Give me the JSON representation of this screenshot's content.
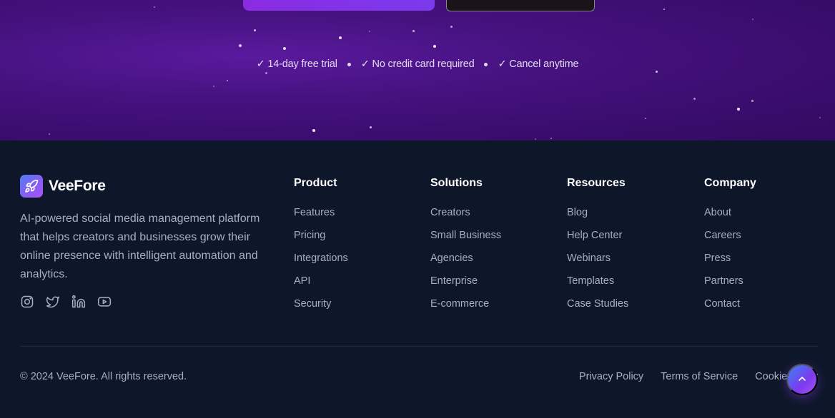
{
  "hero": {
    "primary_cta": "",
    "secondary_cta": "",
    "trust_items": [
      "✓ 14-day free trial",
      "✓ No credit card required",
      "✓ Cancel anytime"
    ],
    "colors": {
      "background": "#3a0d6e",
      "accent": "#7c3aed"
    }
  },
  "footer": {
    "brand": {
      "name": "VeeFore",
      "description": "AI-powered social media management platform that helps creators and businesses grow their online presence with intelligent automation and analytics.",
      "logo_icon": "rocket-icon"
    },
    "socials": [
      "instagram-icon",
      "twitter-icon",
      "linkedin-icon",
      "youtube-icon"
    ],
    "columns": [
      {
        "title": "Product",
        "links": [
          "Features",
          "Pricing",
          "Integrations",
          "API",
          "Security"
        ]
      },
      {
        "title": "Solutions",
        "links": [
          "Creators",
          "Small Business",
          "Agencies",
          "Enterprise",
          "E-commerce"
        ]
      },
      {
        "title": "Resources",
        "links": [
          "Blog",
          "Help Center",
          "Webinars",
          "Templates",
          "Case Studies"
        ]
      },
      {
        "title": "Company",
        "links": [
          "About",
          "Careers",
          "Press",
          "Partners",
          "Contact"
        ]
      }
    ],
    "copyright": "© 2024 VeeFore. All rights reserved.",
    "legal_links": [
      "Privacy Policy",
      "Terms of Service",
      "Cookie Policy"
    ],
    "scroll_top_icon": "chevron-up-icon",
    "colors": {
      "background": "#0e1729",
      "text_muted": "#a7b0c0",
      "heading": "#ffffff"
    }
  }
}
